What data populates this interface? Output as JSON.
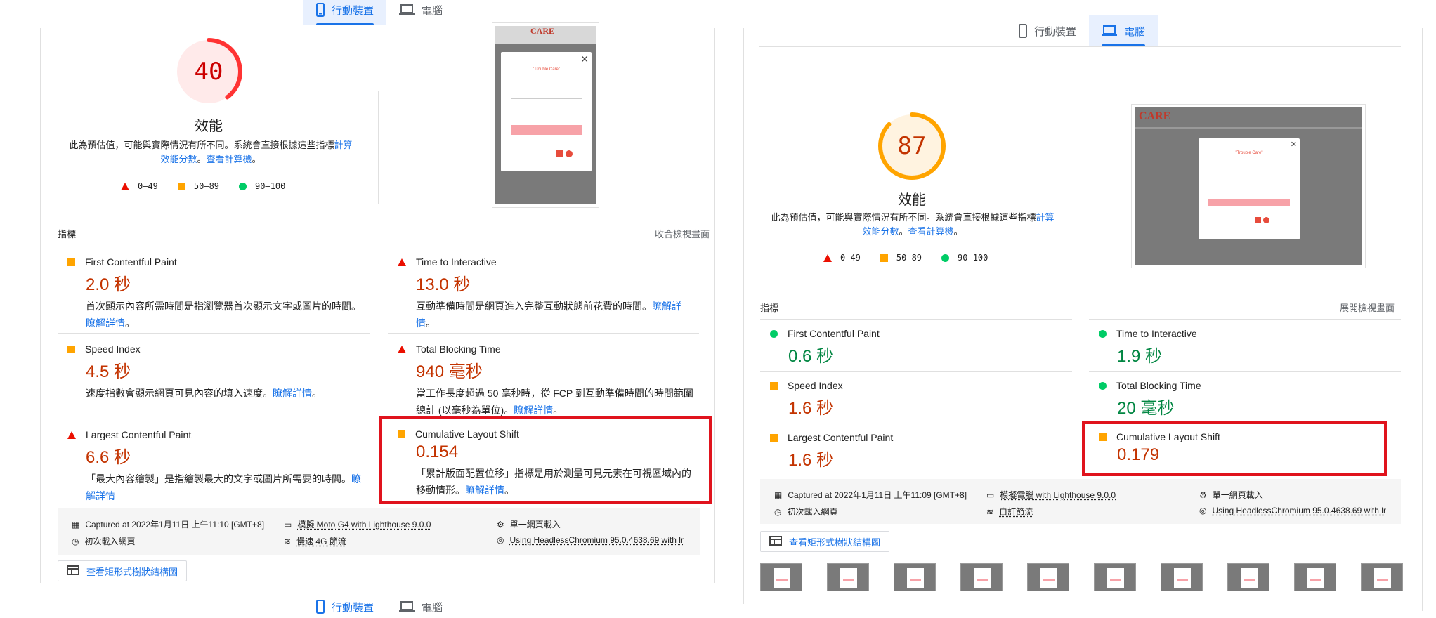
{
  "left": {
    "tabs": [
      {
        "label": "行動裝置",
        "active": true,
        "icon": "phone-icon"
      },
      {
        "label": "電腦",
        "active": false,
        "icon": "laptop-icon"
      }
    ],
    "bottom_tabs": [
      {
        "label": "行動裝置",
        "active": false
      },
      {
        "label": "電腦",
        "active": false
      }
    ],
    "score": "40",
    "score_color": "#ff3333",
    "gauge_title": "效能",
    "note_text": "此為預估值，可能與實際情況有所不同。系統會直接根據這些指標",
    "note_link1": "計算效能分數",
    "note_sep": "。",
    "note_link2": "查看計算機",
    "note_end": "。",
    "legend": [
      "0–49",
      "50–89",
      "90–100"
    ],
    "section_title": "指標",
    "toggle_label": "收合檢視畫面",
    "metrics": [
      {
        "name": "First Contentful Paint",
        "value": "2.0 秒",
        "rating": "average",
        "desc": "首次顯示內容所需時間是指瀏覽器首次顯示文字或圖片的時間。",
        "link": "瞭解詳情",
        "end": "。"
      },
      {
        "name": "Time to Interactive",
        "value": "13.0 秒",
        "rating": "fail",
        "desc": "互動準備時間是網頁進入完整互動狀態前花費的時間。",
        "link": "瞭解詳情",
        "end": "。"
      },
      {
        "name": "Speed Index",
        "value": "4.5 秒",
        "rating": "average",
        "desc": "速度指數會顯示網頁可見內容的填入速度。",
        "link": "瞭解詳情",
        "end": "。"
      },
      {
        "name": "Total Blocking Time",
        "value": "940 毫秒",
        "rating": "fail",
        "desc": "當工作長度超過 50 毫秒時，從 FCP 到互動準備時間的時間範圍總計 (以毫秒為單位)。",
        "link": "瞭解詳情",
        "end": "。"
      },
      {
        "name": "Largest Contentful Paint",
        "value": "6.6 秒",
        "rating": "fail",
        "desc": "「最大內容繪製」是指繪製最大的文字或圖片所需要的時間。",
        "link": "瞭解詳情",
        "end": ""
      },
      {
        "name": "Cumulative Layout Shift",
        "value": "0.154",
        "rating": "average",
        "desc": "「累計版面配置位移」指標是用於測量可見元素在可視區域內的移動情形。",
        "link": "瞭解詳情",
        "end": "。"
      }
    ],
    "info": {
      "captured": "Captured at 2022年1月11日 上午11:10 [GMT+8]",
      "device": "模擬 Moto G4 with Lighthouse 9.0.0",
      "page_load": "單一網頁載入",
      "initial": "初次載入網頁",
      "network": "慢速 4G 節流",
      "browser": "Using HeadlessChromium 95.0.4638.69 with lr"
    },
    "treemap_button": "查看矩形式樹狀結構圖"
  },
  "right": {
    "tabs": [
      {
        "label": "行動裝置",
        "active": false,
        "icon": "phone-icon"
      },
      {
        "label": "電腦",
        "active": true,
        "icon": "laptop-icon"
      }
    ],
    "score": "87",
    "score_color": "#ffa400",
    "gauge_title": "效能",
    "note_text": "此為預估值，可能與實際情況有所不同。系統會直接根據這些指標",
    "note_link1": "計算效能分數",
    "note_sep": "。",
    "note_link2": "查看計算機",
    "note_end": "。",
    "legend": [
      "0–49",
      "50–89",
      "90–100"
    ],
    "section_title": "指標",
    "toggle_label": "展開檢視畫面",
    "metrics": [
      {
        "name": "First Contentful Paint",
        "value": "0.6 秒",
        "rating": "pass"
      },
      {
        "name": "Time to Interactive",
        "value": "1.9 秒",
        "rating": "pass"
      },
      {
        "name": "Speed Index",
        "value": "1.6 秒",
        "rating": "average"
      },
      {
        "name": "Total Blocking Time",
        "value": "20 毫秒",
        "rating": "pass"
      },
      {
        "name": "Largest Contentful Paint",
        "value": "1.6 秒",
        "rating": "average"
      },
      {
        "name": "Cumulative Layout Shift",
        "value": "0.179",
        "rating": "average"
      }
    ],
    "info": {
      "captured": "Captured at 2022年1月11日 上午11:09 [GMT+8]",
      "device": "模擬電腦 with Lighthouse 9.0.0",
      "page_load": "單一網頁載入",
      "initial": "初次載入網頁",
      "network": "自訂節流",
      "browser": "Using HeadlessChromium 95.0.4638.69 with lr"
    },
    "treemap_button": "查看矩形式樹狀結構圖"
  },
  "colors": {
    "fail": "#eb0f00",
    "average": "#ffa400",
    "pass": "#00cc66",
    "link": "#1a73e8",
    "highlight": "#e0131d"
  },
  "screenshot_logo": "CARE",
  "screenshot_popup_line": "\"Trouble Care\""
}
